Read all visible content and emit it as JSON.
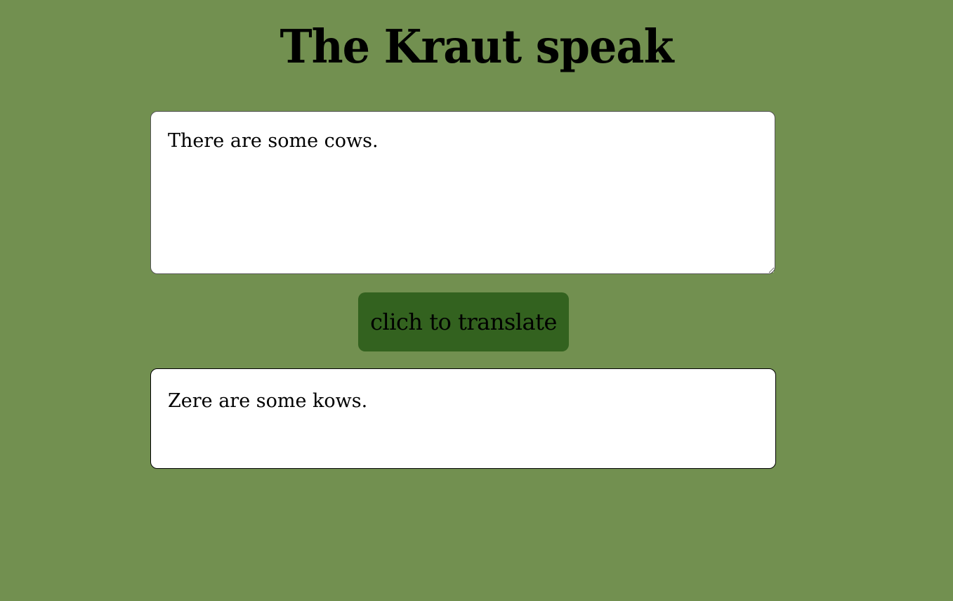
{
  "header": {
    "title": "The Kraut speak"
  },
  "input": {
    "value": "There are some cows."
  },
  "translate_button": {
    "label": "clich to translate"
  },
  "output": {
    "text": "Zere are some kows."
  },
  "colors": {
    "background": "#729050",
    "button": "#33621f",
    "box": "#ffffff"
  }
}
